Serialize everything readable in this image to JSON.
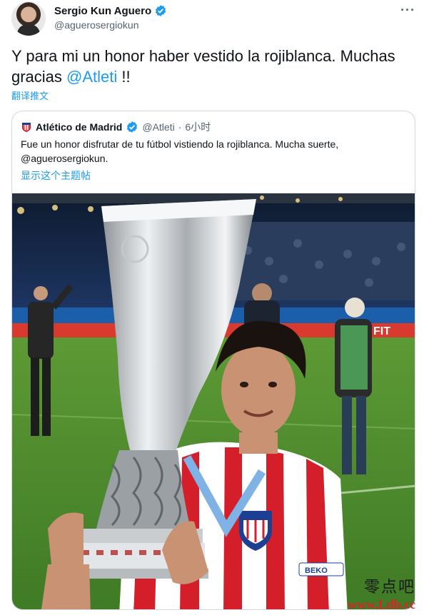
{
  "author": {
    "name": "Sergio Kun Aguero",
    "handle": "@aguerosergiokun",
    "verified_icon": "verified-badge-icon"
  },
  "tweet": {
    "text_before": "Y para mi un honor haber vestido la rojiblanca. Muchas gracias ",
    "mention": "@Atleti",
    "text_after": " !!",
    "translate_label": "翻译推文"
  },
  "more_label": "···",
  "quoted": {
    "name": "Atlético de Madrid",
    "handle": "@Atleti",
    "separator": "·",
    "time": "6小时",
    "text": "Fue un honor disfrutar de tu fútbol vistiendo la rojiblanca. Mucha suerte, @aguerosergiokun.",
    "show_thread": "显示这个主题帖"
  },
  "photo": {
    "alt_subject": "player-holding-trophy",
    "sponsor_patch": "BEKO",
    "board_text": "FIT"
  },
  "watermark": {
    "cn": "零点吧",
    "url": "www.Ldb.cc"
  },
  "colors": {
    "link": "#1d9bf0",
    "verified": "#1d9bf0",
    "stripe_red": "#d41f2b",
    "pitch": "#4e8a2e"
  }
}
